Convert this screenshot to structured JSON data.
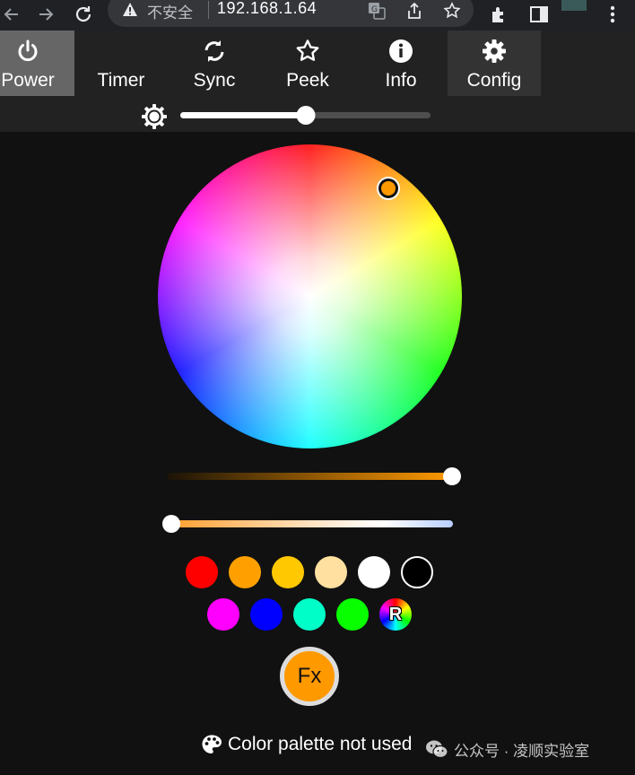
{
  "browser": {
    "insecure_label": "不安全",
    "url": "192.168.1.64"
  },
  "nav": {
    "tabs": [
      {
        "label": "Power",
        "icon": "power-icon",
        "active": true
      },
      {
        "label": "Timer",
        "icon": "moon-icon"
      },
      {
        "label": "Sync",
        "icon": "sync-icon"
      },
      {
        "label": "Peek",
        "icon": "star-icon"
      },
      {
        "label": "Info",
        "icon": "info-icon"
      },
      {
        "label": "Config",
        "icon": "gear-icon"
      }
    ]
  },
  "brightness": {
    "icon": "brightness-icon",
    "value": 0.5
  },
  "color_wheel": {
    "selected_color": "#ff9900",
    "hue_deg": 36,
    "saturation": 0.88
  },
  "value_slider": {
    "value": 1.0
  },
  "white_balance_slider": {
    "value": 0.0
  },
  "quick_colors": [
    [
      "#ff0000",
      "#ffa000",
      "#ffc800",
      "#ffe0a0",
      "#ffffff",
      "#000000"
    ],
    [
      "#ff00ff",
      "#0000ff",
      "#00ffc8",
      "#08ff00",
      "rainbow"
    ]
  ],
  "random_label": "R",
  "fx_button": {
    "label": "Fx"
  },
  "palette_status": "Color palette not used",
  "watermark": "公众号 · 凌顺实验室",
  "colors": {
    "background": "#111111",
    "accent": "#ff9900",
    "nav_background": "#222222",
    "tab_active": "#666666"
  }
}
